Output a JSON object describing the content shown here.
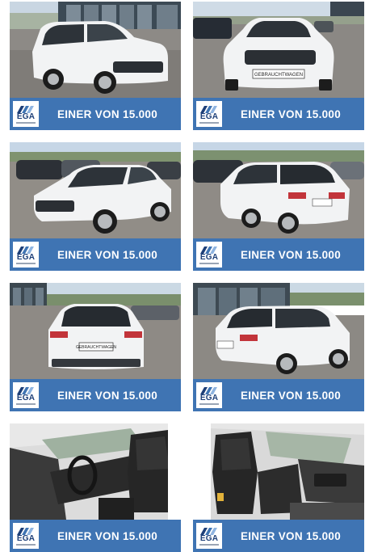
{
  "gallery": {
    "logo_text": "EGA",
    "tiles": [
      {
        "view": "front-left-exterior",
        "caption": "EINER VON 15.000"
      },
      {
        "view": "front-exterior",
        "caption": "EINER VON 15.000",
        "plate": "GEBRAUCHTWAGEN"
      },
      {
        "view": "front-left-angle",
        "caption": "EINER VON 15.000"
      },
      {
        "view": "rear-left-angle",
        "caption": "EINER VON 15.000"
      },
      {
        "view": "rear-exterior",
        "caption": "EINER VON 15.000",
        "plate": "GEBRAUCHTWAGEN"
      },
      {
        "view": "rear-left-side",
        "caption": "EINER VON 15.000"
      },
      {
        "view": "interior-driver-side",
        "caption": "EINER VON 15.000"
      },
      {
        "view": "interior-passenger-side",
        "caption": "EINER VON 15.000"
      }
    ]
  },
  "colors": {
    "banner": "#3f74b3",
    "car_body": "#f2f3f4",
    "asphalt": "#8d8a86",
    "logo_blue": "#1d3f78"
  }
}
